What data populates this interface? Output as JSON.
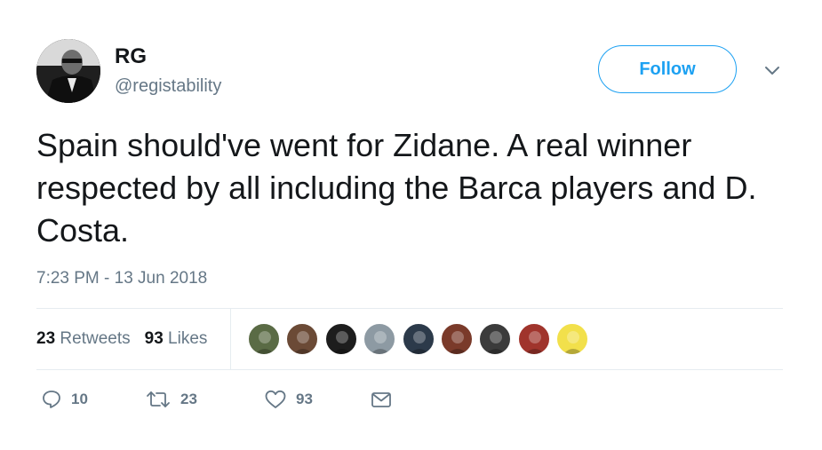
{
  "user": {
    "name": "RG",
    "handle": "@registability"
  },
  "follow_label": "Follow",
  "tweet": {
    "text": "Spain should've went for Zidane. A real winner respected by all including the Barca players and D. Costa.",
    "timestamp": "7:23 PM - 13 Jun 2018"
  },
  "stats": {
    "retweets_count": "23",
    "retweets_label": "Retweets",
    "likes_count": "93",
    "likes_label": "Likes"
  },
  "likers": [
    {
      "color": "#5a6b45"
    },
    {
      "color": "#6b4a36"
    },
    {
      "color": "#1d1d1d"
    },
    {
      "color": "#8d9aa3"
    },
    {
      "color": "#2c3a4a"
    },
    {
      "color": "#7a3a2a"
    },
    {
      "color": "#3b3b3b"
    },
    {
      "color": "#a0342c"
    },
    {
      "color": "#f2e04b"
    }
  ],
  "actions": {
    "reply_count": "10",
    "retweet_count": "23",
    "like_count": "93"
  },
  "colors": {
    "accent": "#1da1f2",
    "secondary_text": "#657786",
    "divider": "#e6ecf0"
  },
  "icons": [
    "chevron-down-icon",
    "reply-icon",
    "retweet-icon",
    "heart-icon",
    "message-icon"
  ]
}
